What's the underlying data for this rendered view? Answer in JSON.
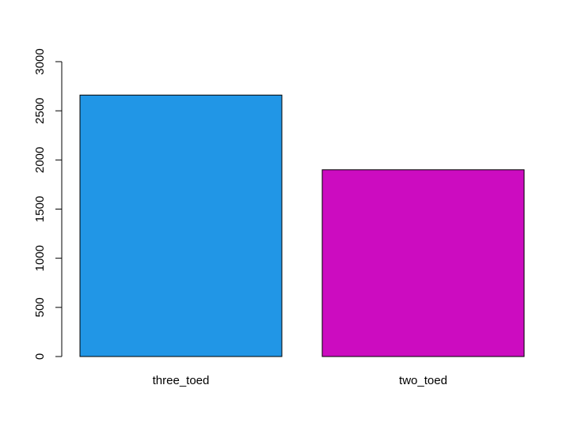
{
  "chart_data": {
    "type": "bar",
    "title": "",
    "xlabel": "",
    "ylabel": "",
    "categories": [
      "three_toed",
      "two_toed"
    ],
    "values": [
      2660,
      1900
    ],
    "colors": [
      "#2196E6",
      "#CC0CC0"
    ],
    "ylim": [
      0,
      3000
    ],
    "y_ticks": [
      "0",
      "500",
      "1000",
      "1500",
      "2000",
      "2500",
      "3000"
    ],
    "grid": false,
    "legend": "none"
  }
}
